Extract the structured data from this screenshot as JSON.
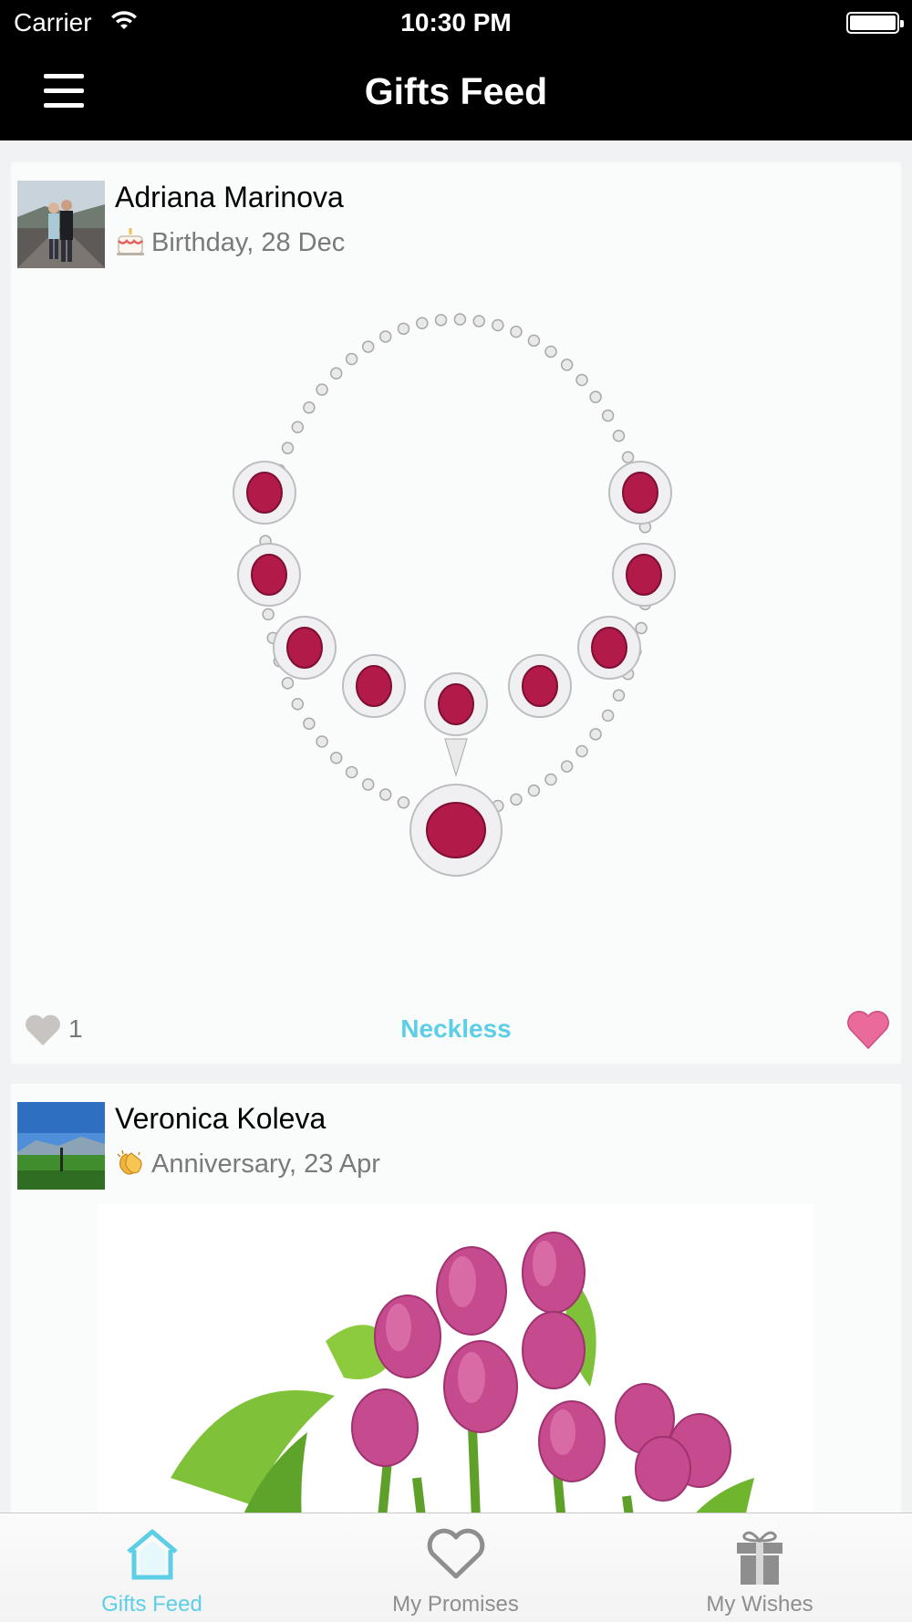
{
  "status_bar": {
    "carrier": "Carrier",
    "time": "10:30 PM"
  },
  "nav": {
    "title": "Gifts Feed",
    "menu_icon": "hamburger-menu-icon"
  },
  "feed": [
    {
      "user_name": "Adriana Marinova",
      "occasion_icon": "birthday-cake-icon",
      "occasion": "Birthday, 28 Dec",
      "gift_title": "Neckless",
      "like_count": "1",
      "gift_image": "ruby-diamond-necklace"
    },
    {
      "user_name": "Veronica Koleva",
      "occasion_icon": "clapping-hands-icon",
      "occasion": "Anniversary, 23 Apr",
      "gift_image": "pink-tulips-bouquet"
    }
  ],
  "tabs": [
    {
      "label": "Gifts Feed",
      "icon": "home-icon",
      "active": true
    },
    {
      "label": "My Promises",
      "icon": "heart-outline-icon",
      "active": false
    },
    {
      "label": "My Wishes",
      "icon": "gift-icon",
      "active": false
    }
  ],
  "colors": {
    "accent": "#5ccfe6",
    "promise_heart": "#ea6a9b",
    "like_heart": "#c7c4c1",
    "topbar": "#000000"
  }
}
